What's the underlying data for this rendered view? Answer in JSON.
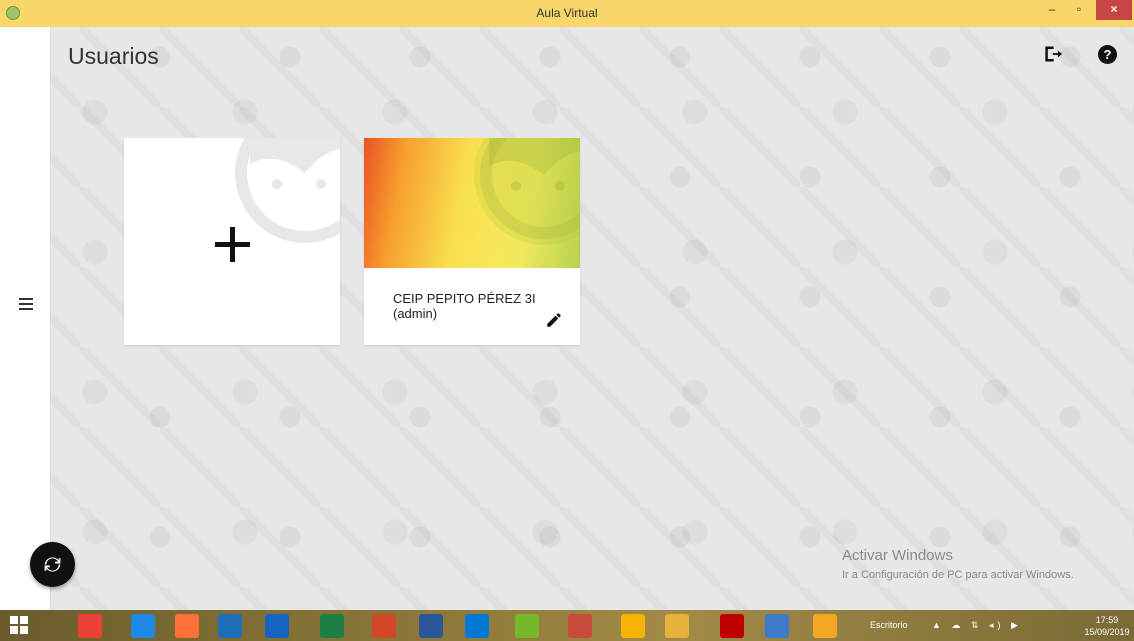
{
  "window": {
    "title": "Aula Virtual",
    "minimize_glyph": "–",
    "maximize_glyph": "▫",
    "close_glyph": "×"
  },
  "header": {
    "title": "Usuarios",
    "icons": [
      "logout-icon",
      "help-icon"
    ],
    "help_glyph": "?"
  },
  "sidebar": {
    "icons": [
      "menu-icon"
    ]
  },
  "cards": [
    {
      "type": "add-user",
      "icon": "plus-icon"
    },
    {
      "type": "user",
      "name": "CEIP PEPITO PÉREZ 3I",
      "role": "(admin)",
      "icon": "edit-icon"
    }
  ],
  "fab": {
    "icon": "refresh-icon"
  },
  "activation_watermark": {
    "title": "Activar Windows",
    "subtitle": "Ir a Configuración de PC para activar Windows."
  },
  "taskbar": {
    "desktop_label": "Escritorio",
    "tray_glyphs": "▲ ☁ ⇅ ◂) ▶",
    "time": "17:59",
    "date": "15/09/2019",
    "apps": [
      "chrome-icon",
      "edge-icon",
      "firefox-icon",
      "media-icon",
      "outlook-icon",
      "excel-icon",
      "powerpoint-icon",
      "word-icon",
      "onedrive-icon",
      "utorrent-icon",
      "snipping-icon",
      "drive-icon",
      "explorer-icon",
      "acrobat-icon",
      "remote-icon",
      "aula-virtual-icon"
    ],
    "app_colors": [
      "#e94235",
      "#1e88e5",
      "#ff7139",
      "#1e6fb8",
      "#1565c0",
      "#1e7e45",
      "#d24726",
      "#2b579a",
      "#0078d4",
      "#76b82a",
      "#c64b3b",
      "#f4b400",
      "#e6b23b",
      "#c00000",
      "#3d7ac9",
      "#f5a623"
    ]
  },
  "colors": {
    "title_bar": "#f8d66a",
    "close_button": "#c84545",
    "card_bg": "#ffffff",
    "banner_start": "#e95224",
    "banner_end": "#c3da57",
    "fab": "#111111"
  }
}
